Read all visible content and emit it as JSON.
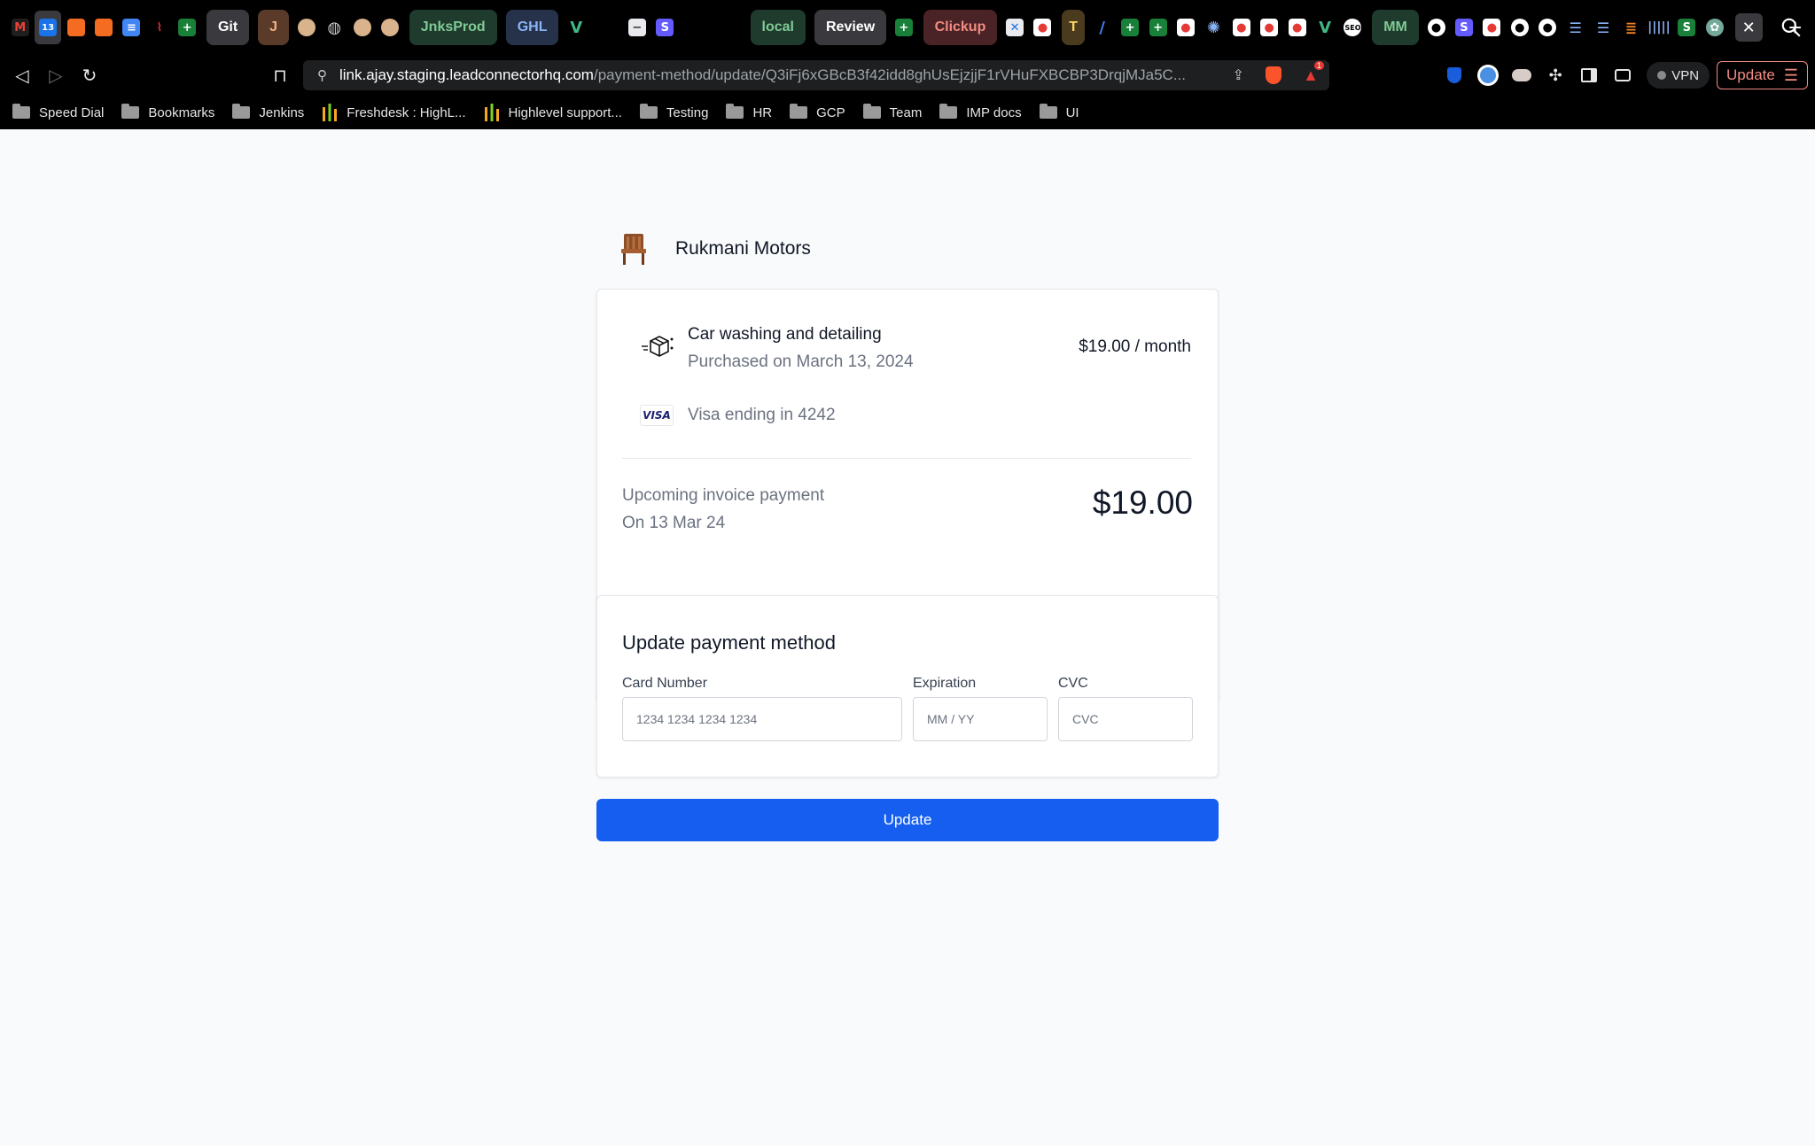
{
  "browser": {
    "tabs": {
      "pill_git": "Git",
      "pill_j": "J",
      "pill_jnksprod": "JnksProd",
      "pill_ghl": "GHL",
      "pill_local": "local",
      "pill_review": "Review",
      "pill_clickup": "Clickup",
      "pill_t": "T",
      "pill_mm": "MM"
    },
    "url_host": "link.ajay.staging.leadconnectorhq.com",
    "url_path": "/payment-method/update/Q3iFj6xGBcB3f42idd8ghUsEjzjjF1rVHuFXBCBP3DrqjMJa5C...",
    "vpn_label": "VPN",
    "update_label": "Update",
    "notification_count": "1",
    "bookmarks": [
      {
        "label": "Speed Dial",
        "icon": "folder"
      },
      {
        "label": "Bookmarks",
        "icon": "folder"
      },
      {
        "label": "Jenkins",
        "icon": "folder"
      },
      {
        "label": "Freshdesk : HighL...",
        "icon": "freshdesk"
      },
      {
        "label": "Highlevel support...",
        "icon": "freshdesk"
      },
      {
        "label": "Testing",
        "icon": "folder"
      },
      {
        "label": "HR",
        "icon": "folder"
      },
      {
        "label": "GCP",
        "icon": "folder"
      },
      {
        "label": "Team",
        "icon": "folder"
      },
      {
        "label": "IMP docs",
        "icon": "folder"
      },
      {
        "label": "UI",
        "icon": "folder"
      }
    ]
  },
  "brand": {
    "name": "Rukmani Motors",
    "logo_icon": "chair-icon"
  },
  "subscription": {
    "name": "Car washing and detailing",
    "purchased": "Purchased on March 13, 2024",
    "price": "$19.00 / month",
    "icon": "box-icon"
  },
  "payment": {
    "card_brand": "VISA",
    "card_text": "Visa ending in 4242"
  },
  "upcoming": {
    "label": "Upcoming invoice payment",
    "date": "On 13 Mar 24",
    "amount": "$19.00"
  },
  "update_form": {
    "title": "Update payment method",
    "card_number_label": "Card Number",
    "card_number_placeholder": "1234 1234 1234 1234",
    "expiration_label": "Expiration",
    "expiration_placeholder": "MM / YY",
    "cvc_label": "CVC",
    "cvc_placeholder": "CVC",
    "submit_label": "Update"
  },
  "colors": {
    "primary": "#155eef",
    "text": "#111827",
    "muted": "#6b7280",
    "background": "#f9fafb"
  }
}
